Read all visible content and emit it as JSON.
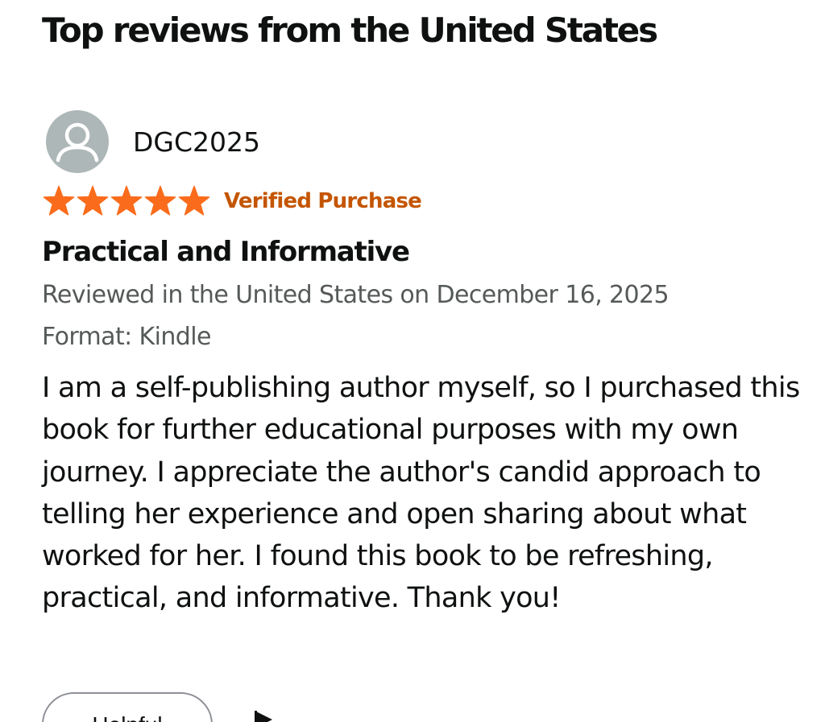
{
  "section": {
    "title": "Top reviews from the United States"
  },
  "review": {
    "author": "DGC2025",
    "avatar_icon": "user-silhouette-icon",
    "rating": 5,
    "rating_max": 5,
    "star_icon": "star-icon",
    "verified_label": "Verified Purchase",
    "title": "Practical and Informative",
    "meta": "Reviewed in the United States on December 16, 2025",
    "format": "Format: Kindle",
    "body": "I am a self-publishing author myself, so I purchased this book for further educational purposes with my own journey. I appreciate the author's candid approach to telling her experience and open sharing about what worked for her. I found this book to be refreshing, practical, and informative. Thank you!"
  },
  "actions": {
    "helpful_label": "Helpful",
    "report_icon": "flag-icon"
  },
  "colors": {
    "star": "#fa6c1c",
    "verified": "#c45500",
    "avatar_bg": "#aeb7b8",
    "text": "#0f1111",
    "meta_text": "#565959",
    "button_border": "#8d9096"
  }
}
